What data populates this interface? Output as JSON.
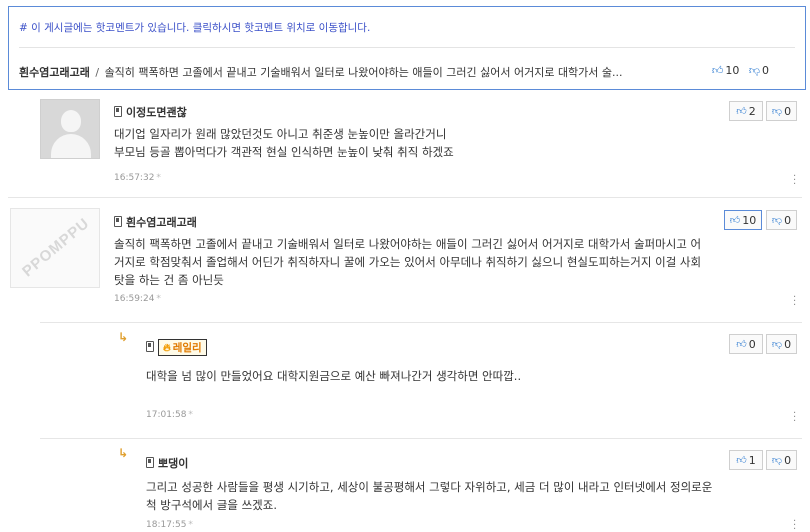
{
  "hot_comment_box": {
    "notice": "# 이 게시글에는 핫코멘트가 있습니다. 클릭하시면 핫코멘트 위치로 이동합니다.",
    "author": "흰수염고래고래",
    "separator": "/",
    "preview": "솔직히 팩폭하면 고졸에서 끝내고 기술배워서 일터로 나왔어야하는 애들이 그러긴 싫어서 어거지로 대학가서 술...",
    "up_count": "10",
    "down_count": "0"
  },
  "comments": [
    {
      "nickname": "이정도면괜찮",
      "line1": "대기업 일자리가 원래 많았던것도 아니고 취준생 눈높이만 올라간거니",
      "line2": "부모님 등골 뽑아먹다가 객관적 현실 인식하면 눈높이 낮춰 취직 하겠죠",
      "time": "16:57:32",
      "up": "2",
      "down": "0"
    },
    {
      "nickname": "흰수염고래고래",
      "avatar_text": "PPOMPPU",
      "line1": "솔직히 팩폭하면 고졸에서 끝내고 기술배워서 일터로 나왔어야하는 애들이 그러긴 싫어서 어거지로 대학가서 술퍼마시고 어",
      "line2": "거지로 학점맞춰서 졸업해서 어딘가 취직하자니 꿀에 가오는 있어서 아무데나 취직하기 싫으니 현실도피하는거지 이걸 사회",
      "line3": "탓을 하는 건 좀 아닌듯",
      "time": "16:59:24",
      "up": "10",
      "down": "0"
    },
    {
      "nickname": "레일리",
      "line1": "대학을 넘 많이 만들었어요 대학지원금으로 예산 빠져나간거 생각하면 안따깝..",
      "time": "17:01:58",
      "up": "0",
      "down": "0"
    },
    {
      "nickname": "뽀댕이",
      "line1": "그리고 성공한 사람들을 평생 시기하고, 세상이 불공평해서 그렇다 자위하고, 세금 더 많이 내라고 인터넷에서 정의로운",
      "line2": "척 방구석에서 글을 쓰겠죠.",
      "time": "18:17:55",
      "up": "1",
      "down": "0"
    }
  ],
  "star": "*",
  "icons": {
    "thumb_up": "thumb-up-icon",
    "thumb_down": "thumb-down-icon",
    "phone": "mobile-icon",
    "reply": "reply-arrow-icon",
    "more": "kebab-menu-icon"
  },
  "colors": {
    "accent": "#2e7bd1",
    "notice": "#3b50c8",
    "badge": "#e07a00"
  }
}
